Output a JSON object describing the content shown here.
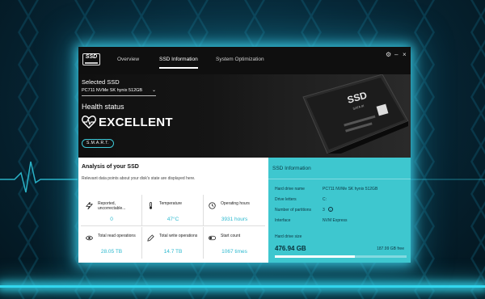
{
  "app": {
    "logo_text": "SSD",
    "nav_tabs": [
      "Overview",
      "SSD Information",
      "System Optimization"
    ],
    "active_tab": 1,
    "window_controls": [
      "gear-icon",
      "minimize-icon",
      "close-icon"
    ]
  },
  "hero": {
    "selected_label": "Selected SSD",
    "selected_value": "PC711 NVMe SK hynix 512GB",
    "health_label": "Health status",
    "health_value": "EXCELLENT",
    "smart_button": "S.M.A.R.T."
  },
  "analysis": {
    "title": "Analysis of your SSD",
    "description": "Relevant data points about your disk's state are displayed here.",
    "cells": [
      {
        "icon": "lightning-icon",
        "label": "Reported, uncorrectable...",
        "value": "0"
      },
      {
        "icon": "thermometer-icon",
        "label": "Temperature",
        "value": "47°C"
      },
      {
        "icon": "clock-icon",
        "label": "Operating hours",
        "value": "3931 hours"
      },
      {
        "icon": "eye-icon",
        "label": "Total read operations",
        "value": "28.05 TB"
      },
      {
        "icon": "pencil-icon",
        "label": "Total write operations",
        "value": "14.7 TB"
      },
      {
        "icon": "toggle-icon",
        "label": "Start count",
        "value": "1067 times"
      }
    ]
  },
  "ssd_info": {
    "title": "SSD Information",
    "rows": [
      {
        "key": "Hard drive name",
        "value": "PC711 NVMe SK hynix 512GB"
      },
      {
        "key": "Drive letters",
        "value": "C:"
      },
      {
        "key": "Number of partitions",
        "value": "3"
      },
      {
        "key": "Interface",
        "value": "NVM Express"
      }
    ],
    "size_label": "Hard drive size",
    "size_value": "476.94 GB",
    "free_value": "187.99 GB free",
    "used_fraction": 0.606
  },
  "colors": {
    "accent": "#3ec7cf",
    "value_text": "#2cb9cf",
    "glow": "#33d7ee"
  }
}
